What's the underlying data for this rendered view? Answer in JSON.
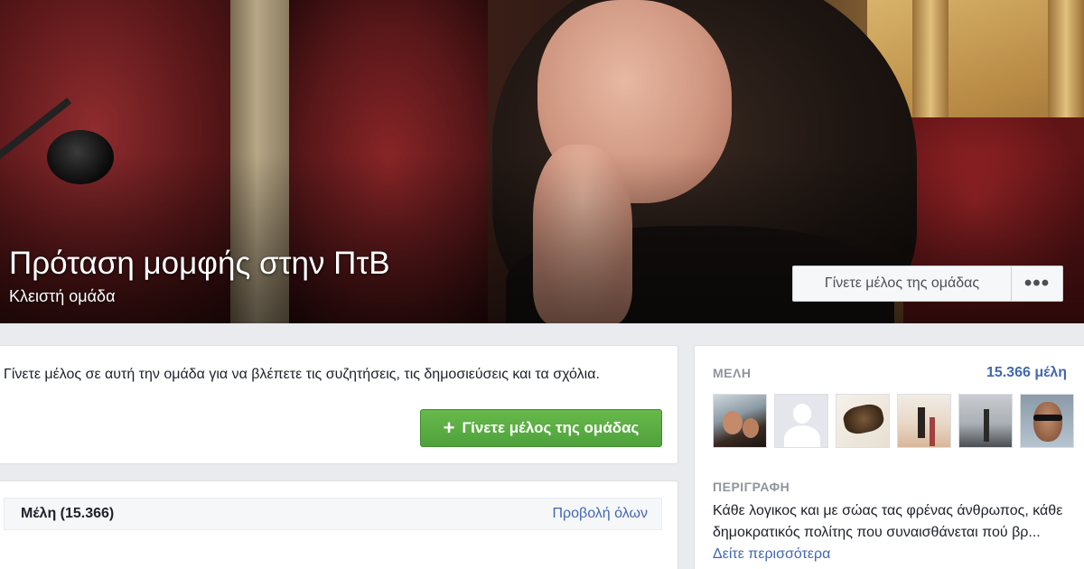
{
  "group": {
    "title": "Πρόταση μομφής στην ΠτΒ",
    "type": "Κλειστή ομάδα",
    "join_label": "Γίνετε μέλος της ομάδας",
    "more_label": "•••"
  },
  "join_card": {
    "text": "Γίνετε μέλος σε αυτή την ομάδα για να βλέπετε τις συζητήσεις, τις δημοσιεύσεις και τα σχόλια.",
    "button_plus": "+",
    "button_label": "Γίνετε μέλος της ομάδας"
  },
  "members_card": {
    "title": "Μέλη (15.366)",
    "view_all": "Προβολή όλων"
  },
  "sidebar": {
    "members_label": "ΜΕΛΗ",
    "members_count": "15.366 μέλη",
    "description_label": "ΠΕΡΙΓΡΑΦΗ",
    "description_text": "Κάθε λογικος και με σώας τας φρένας άνθρωπος, κάθε δημοκρατικός πολίτης που συναισθάνεται πού βρ... ",
    "see_more": "Δείτε περισσότερα"
  },
  "colors": {
    "link": "#4267b2",
    "join_green": "#5aac44",
    "background": "#e9ebee"
  }
}
